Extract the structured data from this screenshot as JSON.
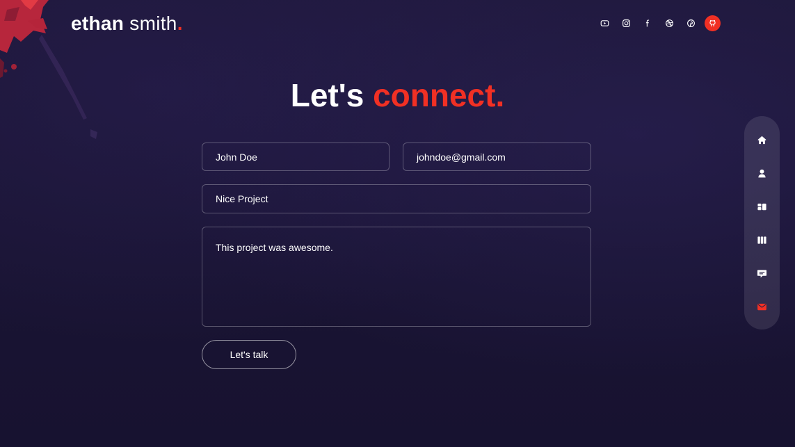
{
  "header": {
    "logo_first": "ethan",
    "logo_last": "smith",
    "logo_dot": ".",
    "socials": [
      {
        "icon": "youtube-icon"
      },
      {
        "icon": "instagram-icon"
      },
      {
        "icon": "facebook-icon"
      },
      {
        "icon": "dribbble-icon"
      },
      {
        "icon": "pinterest-icon"
      },
      {
        "icon": "github-icon",
        "active": true
      }
    ]
  },
  "contact": {
    "heading_prefix": "Let's",
    "heading_accent": "connect.",
    "name_value": "John Doe",
    "email_value": "johndoe@gmail.com",
    "subject_value": "Nice Project",
    "message_value": "This project was awesome.",
    "submit_label": "Let's talk"
  },
  "sidenav": {
    "items": [
      {
        "icon": "home-icon"
      },
      {
        "icon": "user-icon"
      },
      {
        "icon": "services-icon"
      },
      {
        "icon": "work-icon"
      },
      {
        "icon": "testimonials-icon"
      },
      {
        "icon": "contact-icon",
        "active": true
      }
    ]
  },
  "colors": {
    "accent": "#f13024",
    "background": "#1a1533",
    "text": "#ffffff"
  }
}
